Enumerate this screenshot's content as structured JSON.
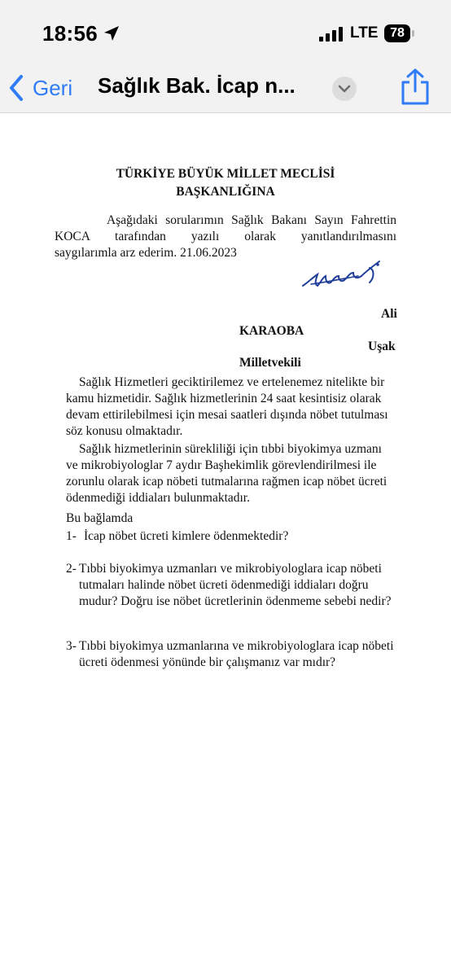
{
  "status_bar": {
    "time": "18:56",
    "network": "LTE",
    "battery": "78"
  },
  "nav": {
    "back_label": "Geri",
    "title": "Sağlık Bak. İcap n..."
  },
  "document": {
    "title_line1": "TÜRKİYE BÜYÜK MİLLET MECLİSİ",
    "title_line2": "BAŞKANLIĞINA",
    "intro_line1": "Aşağıdaki sorularımın Sağlık Bakanı Sayın Fahrettin",
    "intro_line2": "KOCA tarafından yazılı olarak yanıtlandırılmasını",
    "intro_line3": "saygılarımla arz ederim. 21.06.2023",
    "signer": {
      "first": "Ali",
      "last": "KARAOBA",
      "city": "Uşak",
      "role": "Milletvekili"
    },
    "paragraph1": "Sağlık Hizmetleri geciktirilemez ve ertelenemez nitelikte bir kamu hizmetidir. Sağlık hizmetlerinin 24 saat kesintisiz olarak devam ettirilebilmesi için mesai saatleri dışında nöbet tutulması söz konusu olmaktadır.",
    "paragraph2": "Sağlık hizmetlerinin sürekliliği için tıbbi biyokimya uzmanı ve mikrobiyologlar 7 aydır Başhekimlik görevlendirilmesi ile zorunlu olarak icap nöbeti tutmalarına rağmen icap nöbet ücreti ödenmediği iddiaları bulunmaktadır.",
    "lead": "Bu bağlamda",
    "questions": [
      {
        "num": "1-",
        "text": "İcap nöbet ücreti kimlere ödenmektedir?"
      },
      {
        "num": "2-",
        "text": "Tıbbi biyokimya uzmanları ve mikrobiyologlara icap nöbeti tutmaları halinde nöbet ücreti ödenmediği iddiaları doğru mudur? Doğru ise nöbet ücretlerinin ödenmeme sebebi nedir?"
      },
      {
        "num": "3-",
        "text": "Tıbbi biyokimya uzmanlarına ve mikrobiyologlara icap nöbeti ücreti ödenmesi yönünde bir çalışmanız var mıdır?"
      }
    ]
  },
  "colors": {
    "accent": "#2f7cf6",
    "bar_background": "#f2f2f2",
    "signature_ink": "#1f3e9a"
  },
  "icons": [
    "location-arrow-icon",
    "cellular-signal-icon",
    "battery-icon",
    "chevron-left-icon",
    "chevron-down-icon",
    "share-icon",
    "signature-icon"
  ]
}
